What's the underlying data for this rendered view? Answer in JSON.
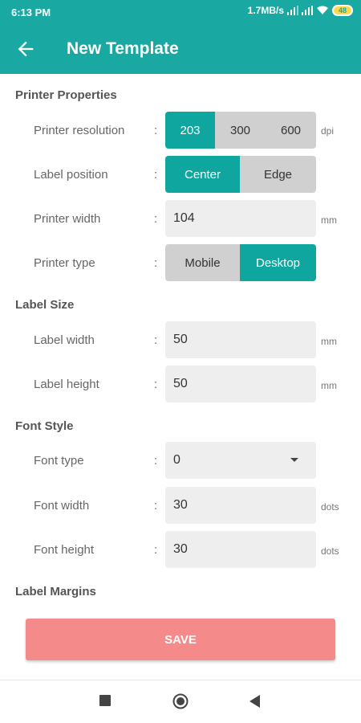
{
  "status_bar": {
    "time": "6:13 PM",
    "speed": "1.7MB/s",
    "battery": "48"
  },
  "app_bar": {
    "title": "New Template",
    "back_icon": "arrow-left-icon"
  },
  "sections": {
    "printer_properties": "Printer Properties",
    "label_size": "Label Size",
    "font_style": "Font Style",
    "label_margins": "Label Margins"
  },
  "printer": {
    "resolution": {
      "label": "Printer resolution",
      "options": [
        "203",
        "300",
        "600"
      ],
      "selected": "203",
      "unit": "dpi"
    },
    "position": {
      "label": "Label position",
      "options": [
        "Center",
        "Edge"
      ],
      "selected": "Center"
    },
    "width": {
      "label": "Printer width",
      "value": "104",
      "unit": "mm"
    },
    "type": {
      "label": "Printer type",
      "options": [
        "Mobile",
        "Desktop"
      ],
      "selected": "Desktop"
    }
  },
  "label_size": {
    "width": {
      "label": "Label width",
      "value": "50",
      "unit": "mm"
    },
    "height": {
      "label": "Label height",
      "value": "50",
      "unit": "mm"
    }
  },
  "font": {
    "type": {
      "label": "Font type",
      "value": "0"
    },
    "width": {
      "label": "Font width",
      "value": "30",
      "unit": "dots"
    },
    "height": {
      "label": "Font height",
      "value": "30",
      "unit": "dots"
    }
  },
  "colon": ":",
  "save_label": "SAVE",
  "colors": {
    "primary": "#1aa9a2",
    "accent": "#0fa6a0",
    "save": "#f48a8a"
  },
  "nav_icons": [
    "recent-apps-icon",
    "home-icon",
    "back-icon"
  ]
}
